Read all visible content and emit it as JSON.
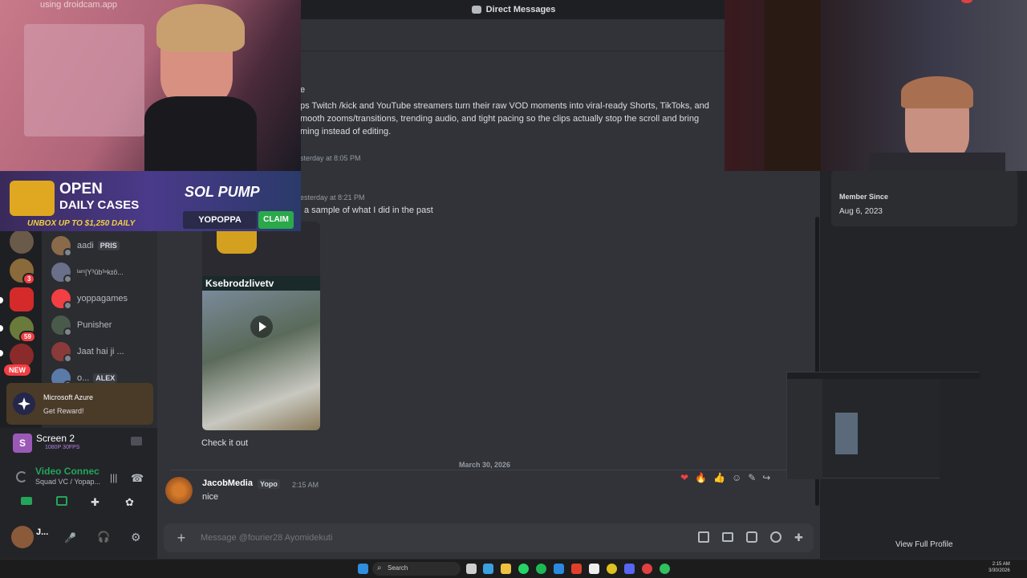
{
  "watermark": "using droidcam.app",
  "window": {
    "title": "Direct Messages"
  },
  "promo": {
    "headline1": "OPEN",
    "headline2": "DAILY CASES",
    "subline": "UNBOX UP TO $1,250 DAILY",
    "brand": "SOL PUMP",
    "code": "YOPOPPA",
    "claim": "CLAIM"
  },
  "servers": [
    {
      "badge": ""
    },
    {
      "badge": "3"
    },
    {
      "badge": ""
    },
    {
      "badge": "59"
    },
    {
      "badge": ""
    }
  ],
  "new_badge": "NEW",
  "dm_list": [
    {
      "name": "aadi",
      "tag": "PRIS",
      "color": "#8a6a4a"
    },
    {
      "name": "ᴵᵃᵐ|Y³ûb³ⁿkɪö...",
      "tag": "",
      "color": "#6a6f8a"
    },
    {
      "name": "yoppagames",
      "tag": "",
      "color": "#f23f43"
    },
    {
      "name": "Punisher",
      "tag": "",
      "color": "#4a5a4a"
    },
    {
      "name": "Jaat hai ji ...",
      "tag": "",
      "color": "#8a3a3a"
    },
    {
      "name": "o...",
      "tag": "ALEX",
      "color": "#5a7aa8"
    }
  ],
  "quest": {
    "title": "Microsoft Azure",
    "action": "Get Reward!"
  },
  "stream": {
    "title": "Screen 2",
    "quality": "1080P 30FPS"
  },
  "voice": {
    "status": "Video Connected",
    "channel": "Squad VC / Yopap..."
  },
  "user": {
    "name": "J..."
  },
  "chat": {
    "intro_line0": "e",
    "intro_line1": "ps Twitch /kick and YouTube streamers turn their raw VOD moments into viral-ready Shorts, TikToks, and",
    "intro_line2": "mooth zooms/transitions, trending audio, and tight pacing so the clips actually stop the scroll and bring",
    "intro_line3": "ming instead of editing.",
    "ts1": "sterday at 8:05 PM",
    "ts2": "esterday at 8:21 PM",
    "sample_text": "a sample of what I did in the past",
    "video_overlay": "Ksebrodzlivetv",
    "check_text": "Check it out",
    "date_divider": "March 30, 2026",
    "last_author": "JacobMedia",
    "last_author_tag": "Yopo",
    "last_time": "2:15 AM",
    "last_text": "nice",
    "input_placeholder": "Message @fourier28 Ayomidekuti"
  },
  "reactions": [
    "❤",
    "🔥",
    "👍"
  ],
  "profile": {
    "member_since_label": "Member Since",
    "member_since_date": "Aug 6, 2023",
    "view_full": "View Full Profile"
  },
  "taskbar": {
    "search": "Search",
    "time": "2:15 AM",
    "date": "3/30/2026"
  }
}
